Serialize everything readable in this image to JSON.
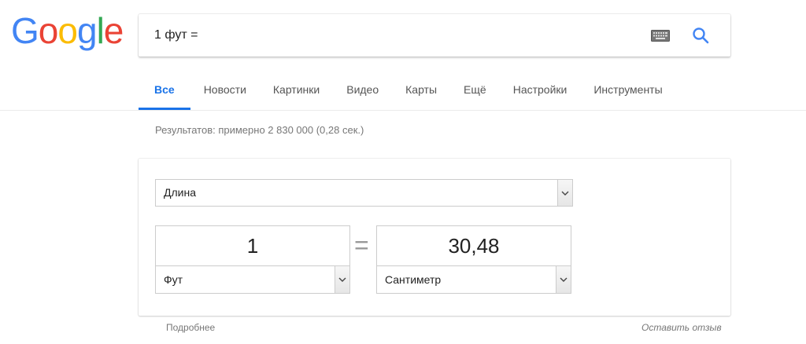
{
  "logo": {
    "letters": [
      "G",
      "o",
      "o",
      "g",
      "l",
      "e"
    ],
    "colors": [
      "#4285F4",
      "#EA4335",
      "#FBBC05",
      "#4285F4",
      "#34A853",
      "#EA4335"
    ]
  },
  "search": {
    "query": "1 фут =",
    "keyboard_icon": "keyboard-icon",
    "search_icon": "search-icon",
    "accent": "#4285F4"
  },
  "tabs": [
    {
      "label": "Все",
      "active": true
    },
    {
      "label": "Новости",
      "active": false
    },
    {
      "label": "Картинки",
      "active": false
    },
    {
      "label": "Видео",
      "active": false
    },
    {
      "label": "Карты",
      "active": false
    },
    {
      "label": "Ещё",
      "active": false
    },
    {
      "label": "Настройки",
      "active": false
    },
    {
      "label": "Инструменты",
      "active": false
    }
  ],
  "result_stats": "Результатов: примерно 2 830 000 (0,28 сек.)",
  "converter": {
    "quantity": "Длина",
    "equals_sign": "=",
    "from": {
      "value": "1",
      "unit": "Фут"
    },
    "to": {
      "value": "30,48",
      "unit": "Сантиметр"
    }
  },
  "footer": {
    "more": "Подробнее",
    "feedback": "Оставить отзыв"
  }
}
